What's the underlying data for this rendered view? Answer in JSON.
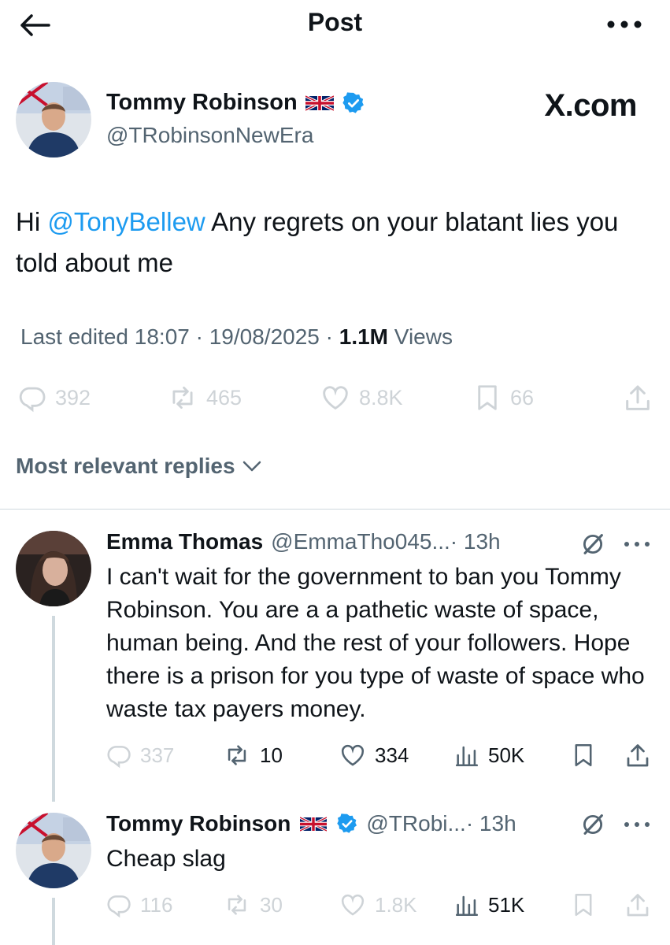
{
  "header": {
    "title": "Post"
  },
  "post": {
    "author_name": "Tommy Robinson",
    "author_handle": "@TRobinsonNewEra",
    "watermark": "X.com",
    "text_prefix": "Hi ",
    "mention": "@TonyBellew",
    "text_suffix": " Any regrets on your blatant lies you told about me",
    "meta_edited": "Last edited 18:07 · 19/08/2025 · ",
    "meta_views_count": "1.1M",
    "meta_views_label": " Views",
    "stats": {
      "replies": "392",
      "reposts": "465",
      "likes": "8.8K",
      "bookmarks": "66"
    }
  },
  "replies_filter": {
    "label": "Most relevant replies"
  },
  "replies": [
    {
      "author_name": "Emma Thomas",
      "author_handle": "@EmmaTho045...",
      "time": " · 13h",
      "text": "I can't wait for the government to ban you Tommy Robinson. You are a a pathetic waste of space, human being. And the rest of your followers. Hope there is a prison for you type of waste of space who waste tax payers money.",
      "stats": {
        "replies": "337",
        "reposts": "10",
        "likes": "334",
        "views": "50K"
      }
    },
    {
      "author_name": "Tommy Robinson",
      "author_handle": "@TRobi...",
      "time": " · 13h",
      "text": "Cheap slag",
      "stats": {
        "replies": "116",
        "reposts": "30",
        "likes": "1.8K",
        "views": "51K"
      }
    }
  ],
  "colors": {
    "accent": "#1d9bf0",
    "text": "#0f1419",
    "secondary": "#536471",
    "divider": "#cfd9de",
    "verified": "#1d9bf0"
  }
}
